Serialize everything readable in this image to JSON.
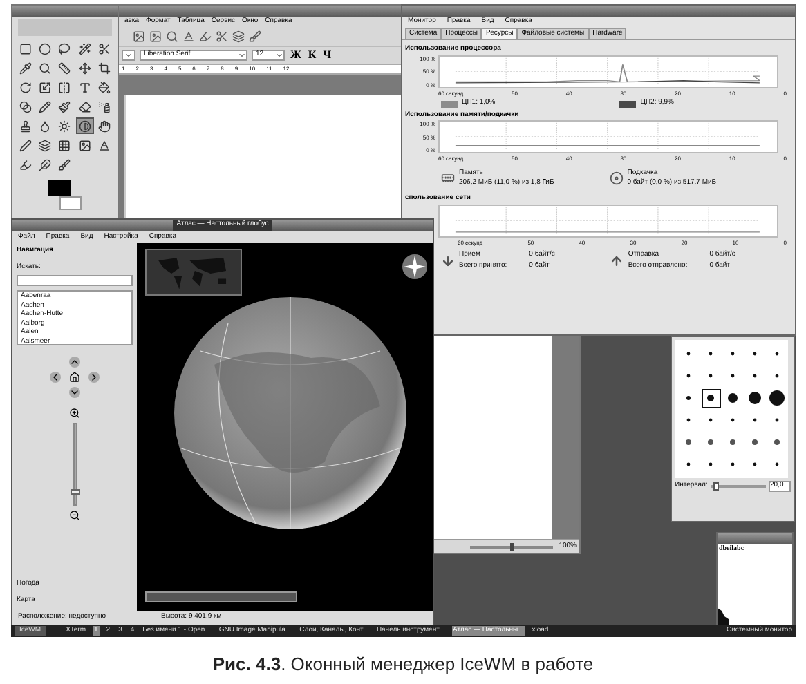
{
  "gimp_toolbox": {
    "tools": [
      {
        "selected": false
      },
      {
        "selected": false
      },
      {
        "selected": false
      },
      {
        "selected": false
      },
      {
        "selected": false
      },
      {
        "selected": false
      },
      {
        "selected": false
      },
      {
        "selected": false
      },
      {
        "selected": false
      },
      {
        "selected": false
      },
      {
        "selected": false
      },
      {
        "selected": false
      },
      {
        "selected": false
      },
      {
        "selected": false
      },
      {
        "selected": false
      },
      {
        "selected": false
      },
      {
        "selected": false
      },
      {
        "selected": false
      },
      {
        "selected": false
      },
      {
        "selected": false
      },
      {
        "selected": false
      },
      {
        "selected": false
      },
      {
        "selected": false
      },
      {
        "selected": true
      },
      {
        "selected": false
      },
      {
        "selected": false
      },
      {
        "selected": false
      },
      {
        "selected": false
      },
      {
        "selected": false
      },
      {
        "selected": false
      },
      {
        "selected": false
      },
      {
        "selected": false
      },
      {
        "selected": false
      }
    ]
  },
  "writer": {
    "menu": [
      "авка",
      "Формат",
      "Таблица",
      "Сервис",
      "Окно",
      "Справка"
    ],
    "font_name": "Liberation Serif",
    "font_size": "12",
    "format_buttons": [
      "Ж",
      "К",
      "Ч"
    ],
    "ruler": [
      "1",
      "2",
      "3",
      "4",
      "5",
      "6",
      "7",
      "8",
      "9",
      "10",
      "11",
      "12"
    ],
    "zoom": "100%",
    "zoom_slider": {
      "level": 0.5
    }
  },
  "system_monitor": {
    "menu": [
      "Монитор",
      "Правка",
      "Вид",
      "Справка"
    ],
    "tabs": [
      {
        "label": "Система",
        "selected": false
      },
      {
        "label": "Процессы",
        "selected": false
      },
      {
        "label": "Ресурсы",
        "selected": true
      },
      {
        "label": "Файловые системы",
        "selected": false
      },
      {
        "label": "Hardware",
        "selected": false
      }
    ],
    "cpu": {
      "title": "Использование процессора",
      "yticks": [
        "100 %",
        "50 %",
        "0 %"
      ],
      "xticks": [
        "60 секунд",
        "50",
        "40",
        "30",
        "20",
        "10",
        "0"
      ],
      "legend": [
        {
          "label": "ЦП1: 1,0%",
          "color": "#8c8c8c"
        },
        {
          "label": "ЦП2: 9,9%",
          "color": "#4a4a4a"
        }
      ]
    },
    "memory": {
      "title": "Использование памяти/подкачки",
      "yticks": [
        "100 %",
        "50 %",
        "0 %"
      ],
      "xticks": [
        "60 секунд",
        "50",
        "40",
        "30",
        "20",
        "10",
        "0"
      ],
      "memory_label": "Память",
      "memory_value": "206,2 МиБ (11,0 %) из 1,8 ГиБ",
      "swap_label": "Подкачка",
      "swap_value": "0 байт (0,0 %) из 517,7 МиБ"
    },
    "network": {
      "title": "спользование сети",
      "xticks": [
        "60 секунд",
        "50",
        "40",
        "30",
        "20",
        "10",
        "0"
      ],
      "receiving_label": "Приём",
      "receiving_rate": "0 байт/с",
      "received_total_label": "Всего принято:",
      "received_total": "0 байт",
      "sending_label": "Отправка",
      "sending_rate": "0 байт/с",
      "sent_total_label": "Всего отправлено:",
      "sent_total": "0 байт"
    }
  },
  "brushes": {
    "spacing_label": "Интервал:",
    "spacing_value": "20,0",
    "spacing_slider": {
      "level": 0.1
    }
  },
  "xload": {
    "text": "dbeilabc"
  },
  "atlas": {
    "title": "Атлас — Настольный глобус",
    "menu": [
      "Файл",
      "Правка",
      "Вид",
      "Настройка",
      "Справка"
    ],
    "navigation": "Навигация",
    "search_label": "Искать:",
    "places": [
      {
        "name": "Aabenraa"
      },
      {
        "name": "Aachen"
      },
      {
        "name": "Aachen-Hutte"
      },
      {
        "name": "Aalborg"
      },
      {
        "name": "Aalen"
      },
      {
        "name": "Aalsmeer"
      }
    ],
    "panels": [
      "Погода",
      "Карта"
    ],
    "zoom_slider": {
      "level": 0.15
    },
    "location": "Расположение: недоступно",
    "altitude": "Высота: 9 401,9 км"
  },
  "taskbar": {
    "start": "IceWM",
    "items": [
      {
        "label": "XTerm",
        "selected": false
      },
      {
        "label": "1",
        "selected": true
      },
      {
        "label": "2",
        "selected": false
      },
      {
        "label": "3",
        "selected": false
      },
      {
        "label": "4",
        "selected": false
      },
      {
        "label": "Без имени 1 - Open...",
        "selected": false
      },
      {
        "label": "GNU Image Manipula...",
        "selected": false
      },
      {
        "label": "Слои, Каналы, Конт...",
        "selected": false
      },
      {
        "label": "Панель инструмент...",
        "selected": false
      },
      {
        "label": "Атлас — Настольны...",
        "selected": true
      },
      {
        "label": "xload",
        "selected": false
      }
    ],
    "right": "Системный монитор"
  },
  "caption": "**Рис. 4.3**. Оконный менеджер IceWM в работе"
}
